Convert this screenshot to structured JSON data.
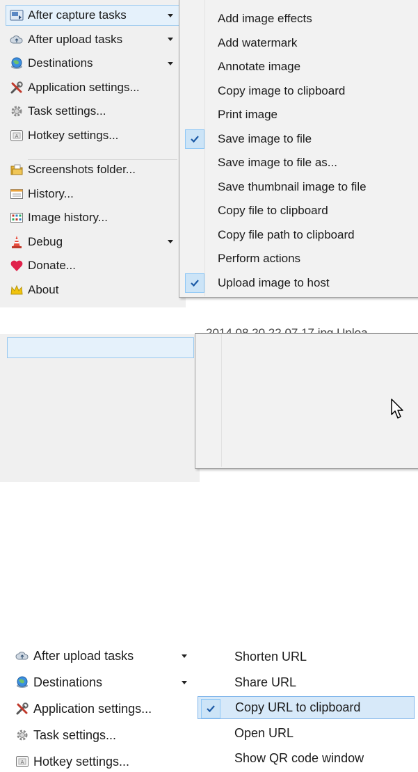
{
  "top": {
    "main_menu": [
      {
        "label": "After capture tasks",
        "icon": "screen-capture-icon",
        "has_submenu": true,
        "highlighted": true
      },
      {
        "label": "After upload tasks",
        "icon": "cloud-upload-icon",
        "has_submenu": true
      },
      {
        "label": "Destinations",
        "icon": "globe-icon",
        "has_submenu": true
      },
      {
        "label": "Application settings...",
        "icon": "tools-icon",
        "has_submenu": false
      },
      {
        "label": "Task settings...",
        "icon": "gear-icon",
        "has_submenu": false
      },
      {
        "label": "Hotkey settings...",
        "icon": "keyboard-key-icon",
        "has_submenu": false
      },
      {
        "label": "Screenshots folder...",
        "icon": "folder-icon",
        "has_submenu": false
      },
      {
        "label": "History...",
        "icon": "history-icon",
        "has_submenu": false
      },
      {
        "label": "Image history...",
        "icon": "image-history-icon",
        "has_submenu": false
      },
      {
        "label": "Debug",
        "icon": "traffic-cone-icon",
        "has_submenu": true
      },
      {
        "label": "Donate...",
        "icon": "heart-icon",
        "has_submenu": false
      },
      {
        "label": "About",
        "icon": "crown-icon",
        "has_submenu": false
      }
    ],
    "submenu": [
      {
        "label": "Add image effects",
        "checked": false
      },
      {
        "label": "Add watermark",
        "checked": false
      },
      {
        "label": "Annotate image",
        "checked": false
      },
      {
        "label": "Copy image to clipboard",
        "checked": false
      },
      {
        "label": "Print image",
        "checked": false
      },
      {
        "label": "Save image to file",
        "checked": true
      },
      {
        "label": "Save image to file as...",
        "checked": false
      },
      {
        "label": "Save thumbnail image to file",
        "checked": false
      },
      {
        "label": "Copy file to clipboard",
        "checked": false
      },
      {
        "label": "Copy file path to clipboard",
        "checked": false
      },
      {
        "label": "Perform actions",
        "checked": false
      },
      {
        "label": "Upload image to host",
        "checked": true
      }
    ]
  },
  "bottom": {
    "background_text": "2014 08 20  22 07 17.jpg      Uploa",
    "main_menu": [
      {
        "label": "After upload tasks",
        "icon": "cloud-upload-icon",
        "has_submenu": true,
        "highlighted": true
      },
      {
        "label": "Destinations",
        "icon": "globe-icon",
        "has_submenu": true
      },
      {
        "label": "Application settings...",
        "icon": "tools-icon",
        "has_submenu": false
      },
      {
        "label": "Task settings...",
        "icon": "gear-icon",
        "has_submenu": false
      },
      {
        "label": "Hotkey settings...",
        "icon": "keyboard-key-icon",
        "has_submenu": false
      }
    ],
    "submenu": [
      {
        "label": "Shorten URL",
        "checked": false
      },
      {
        "label": "Share URL",
        "checked": false
      },
      {
        "label": "Copy URL to clipboard",
        "checked": true,
        "hovered": true
      },
      {
        "label": "Open URL",
        "checked": false
      },
      {
        "label": "Show QR code window",
        "checked": false
      }
    ]
  },
  "colors": {
    "menu_bg": "#f0f0f0",
    "highlight_bg": "#e5f1fb",
    "highlight_border": "#99c9ef",
    "check_box_bg": "#cce4f7",
    "check_mark": "#1c5aa6"
  }
}
